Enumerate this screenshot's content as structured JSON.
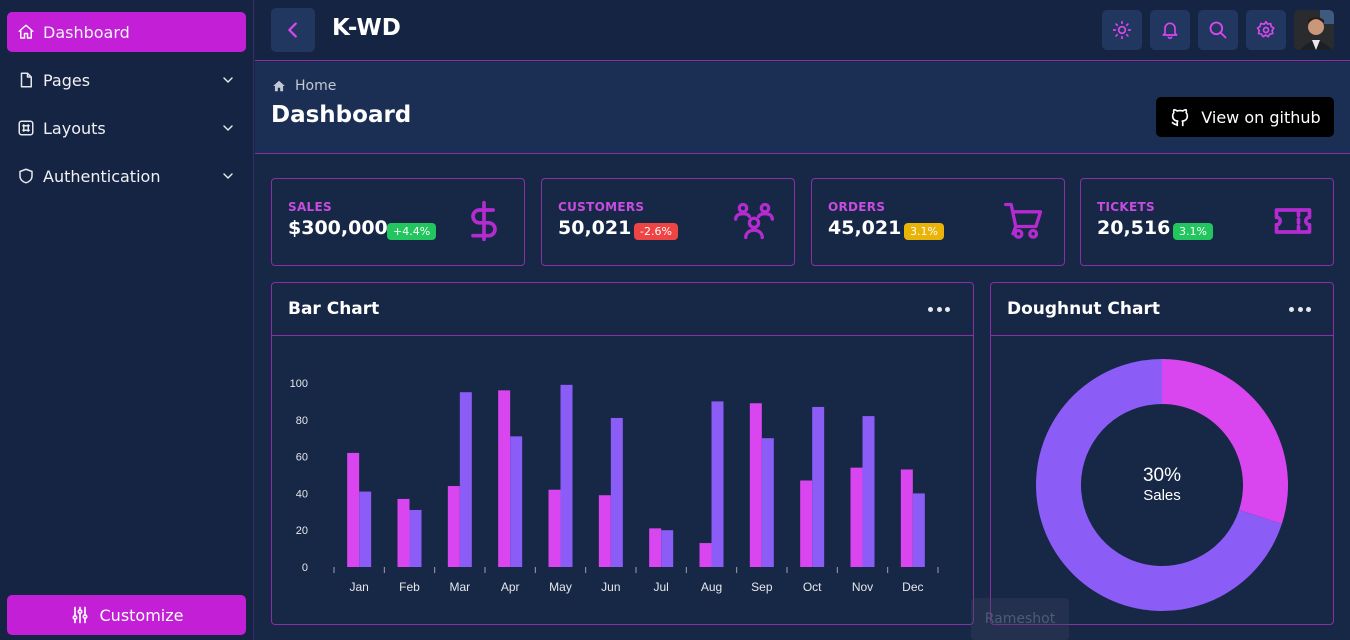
{
  "sidebar": {
    "items": [
      {
        "label": "Dashboard"
      },
      {
        "label": "Pages"
      },
      {
        "label": "Layouts"
      },
      {
        "label": "Authentication"
      }
    ],
    "customize_label": "Customize"
  },
  "topbar": {
    "title": "K-WD",
    "icons": [
      "sun-icon",
      "bell-icon",
      "search-icon",
      "gear-icon"
    ]
  },
  "header": {
    "breadcrumb": "Home",
    "title": "Dashboard",
    "github_label": "View on github"
  },
  "stats": [
    {
      "label": "SALES",
      "value": "$300,000",
      "change": "+4.4%",
      "badge_color": "#22c55e",
      "icon": "dollar-icon"
    },
    {
      "label": "CUSTOMERS",
      "value": "50,021",
      "change": "-2.6%",
      "badge_color": "#ef4444",
      "icon": "users-icon"
    },
    {
      "label": "ORDERS",
      "value": "45,021",
      "change": "3.1%",
      "badge_color": "#eab308",
      "icon": "cart-icon"
    },
    {
      "label": "TICKETS",
      "value": "20,516",
      "change": "3.1%",
      "badge_color": "#22c55e",
      "icon": "ticket-icon"
    }
  ],
  "colors": {
    "accent": "#c21fd6",
    "series_a": "#d946ef",
    "series_b": "#8b5cf6"
  },
  "bar_panel": {
    "title": "Bar Chart"
  },
  "doughnut_panel": {
    "title": "Doughnut Chart",
    "center_value": "30%",
    "center_label": "Sales"
  },
  "watermark": "Rameshot",
  "chart_data": [
    {
      "type": "bar",
      "categories": [
        "Jan",
        "Feb",
        "Mar",
        "Apr",
        "May",
        "Jun",
        "Jul",
        "Aug",
        "Sep",
        "Oct",
        "Nov",
        "Dec"
      ],
      "series": [
        {
          "values": [
            62,
            37,
            44,
            96,
            42,
            39,
            21,
            13,
            89,
            47,
            54,
            53
          ]
        },
        {
          "values": [
            41,
            31,
            95,
            71,
            99,
            81,
            20,
            90,
            70,
            87,
            82,
            40
          ]
        }
      ],
      "ylim": [
        0,
        100
      ],
      "yticks": [
        0,
        20,
        40,
        60,
        80,
        100
      ],
      "grid": false
    },
    {
      "type": "pie",
      "donut": true,
      "slices": [
        {
          "value": 30,
          "color": "#d946ef"
        },
        {
          "value": 70,
          "color": "#8b5cf6"
        }
      ]
    }
  ]
}
